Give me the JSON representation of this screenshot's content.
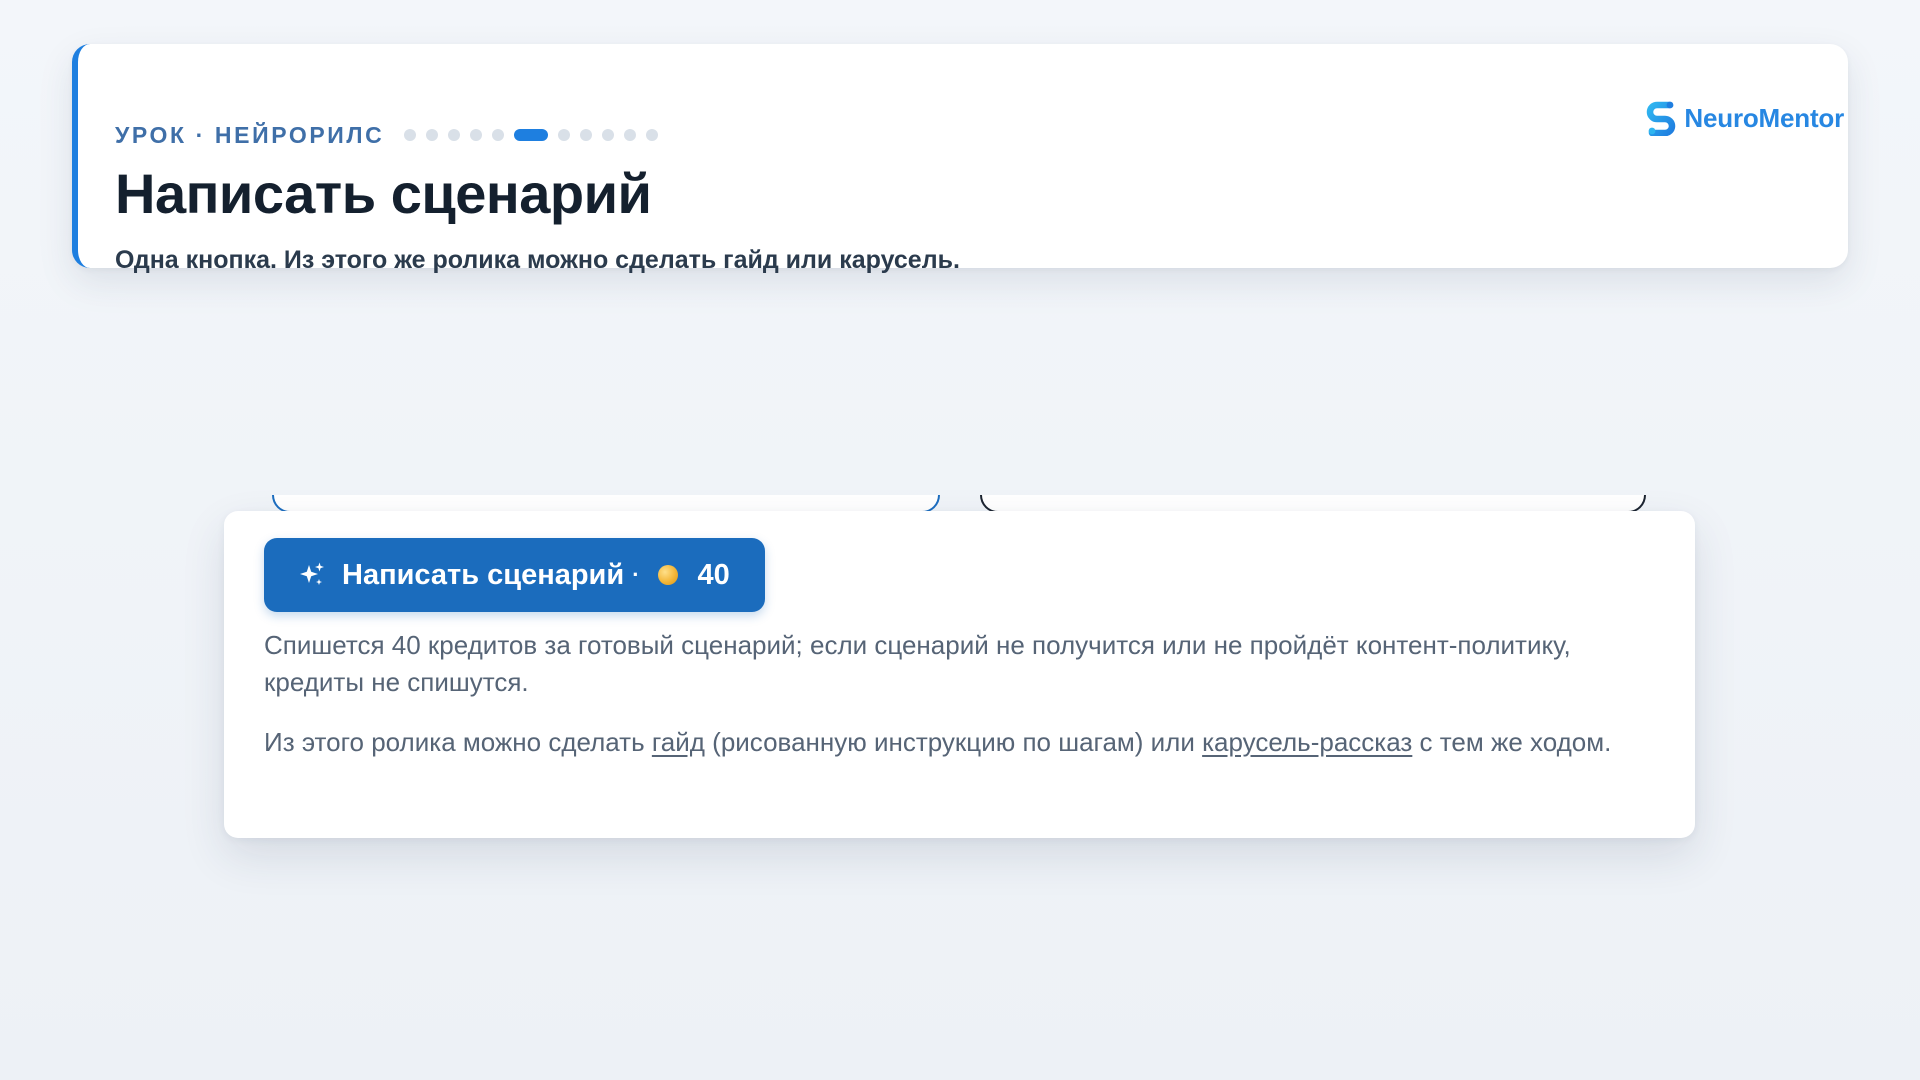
{
  "header": {
    "eyebrow": "Урок · Нейрорилс",
    "progress": {
      "total": 11,
      "current": 6
    },
    "title": "Написать сценарий",
    "subtitle": "Одна кнопка. Из этого же ролика можно сделать гайд или карусель."
  },
  "brand": {
    "name": "NeuroMentor",
    "icon": "neuromentor-logo-icon",
    "color": "#2787e2"
  },
  "action_card": {
    "button": {
      "icon": "sparkle-icon",
      "label": "Написать сценарий",
      "separator": "·",
      "coin_icon": "coin-icon",
      "cost": "40",
      "color": "#1b6cbd"
    },
    "cost_note": "Спишется 40 кредитов за готовый сценарий; если сценарий не получится или не пройдёт контент-политику, кредиты не спишутся.",
    "reuse_note": {
      "before": "Из этого ролика можно сделать ",
      "guide_link": "гайд",
      "middle": " (рисованную инструкцию по шагам) или ",
      "carousel_link": "карусель-рассказ",
      "after": " с тем же ходом."
    }
  },
  "colors": {
    "accent": "#1e7fe0",
    "title": "#14202e",
    "muted_text": "#566476"
  }
}
